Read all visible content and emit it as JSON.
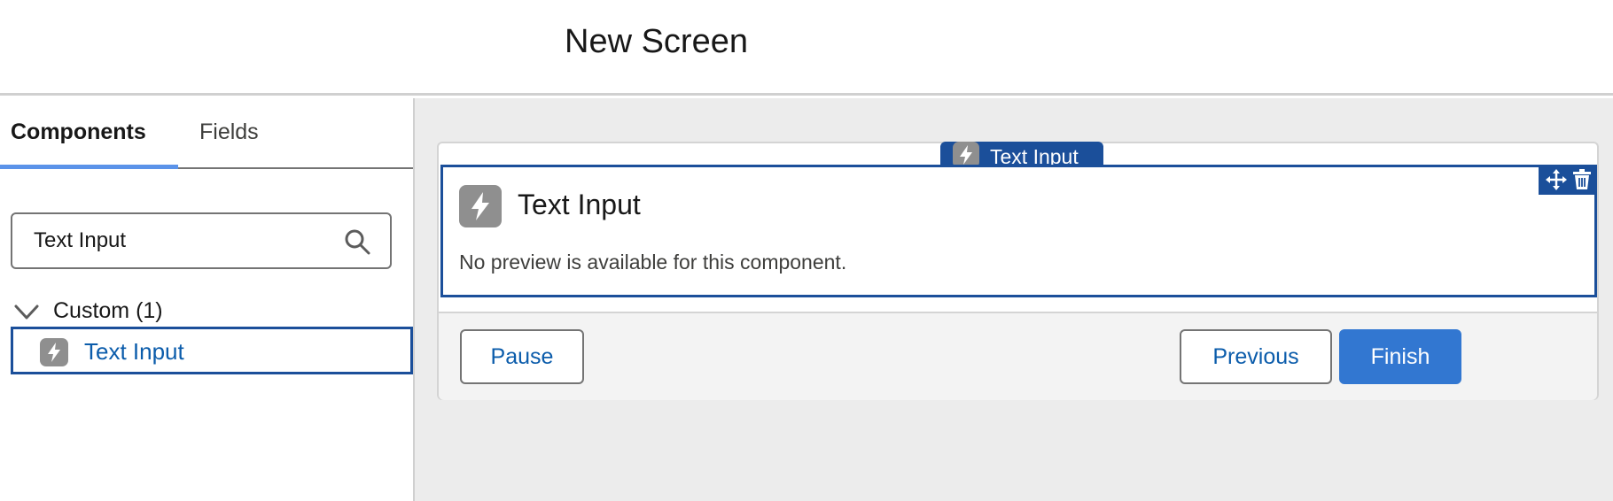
{
  "header": {
    "title": "New Screen"
  },
  "left_panel": {
    "tabs": [
      {
        "label": "Components",
        "active": true
      },
      {
        "label": "Fields",
        "active": false
      }
    ],
    "search": {
      "value": "Text Input",
      "icon": "search-icon"
    },
    "group": {
      "label": "Custom (1)",
      "expanded": true,
      "icon": "chevron-down-icon"
    },
    "items": [
      {
        "label": "Text Input",
        "icon": "lightning-icon",
        "selected": true
      }
    ]
  },
  "canvas": {
    "component_tag": {
      "label": "Text Input",
      "icon": "lightning-icon"
    },
    "component": {
      "title": "Text Input",
      "preview_text": "No preview is available for this component.",
      "icon": "lightning-icon",
      "action_icons": [
        "move-icon",
        "delete-icon"
      ]
    },
    "footer": {
      "pause_label": "Pause",
      "previous_label": "Previous",
      "finish_label": "Finish"
    }
  },
  "colors": {
    "accent_blue": "#1b4f9a",
    "brand_button": "#3277d1",
    "link_blue": "#0b5cab",
    "tab_underline": "#5b93e9",
    "canvas_bg": "#ececec",
    "icon_gray": "#8f8f8f"
  }
}
